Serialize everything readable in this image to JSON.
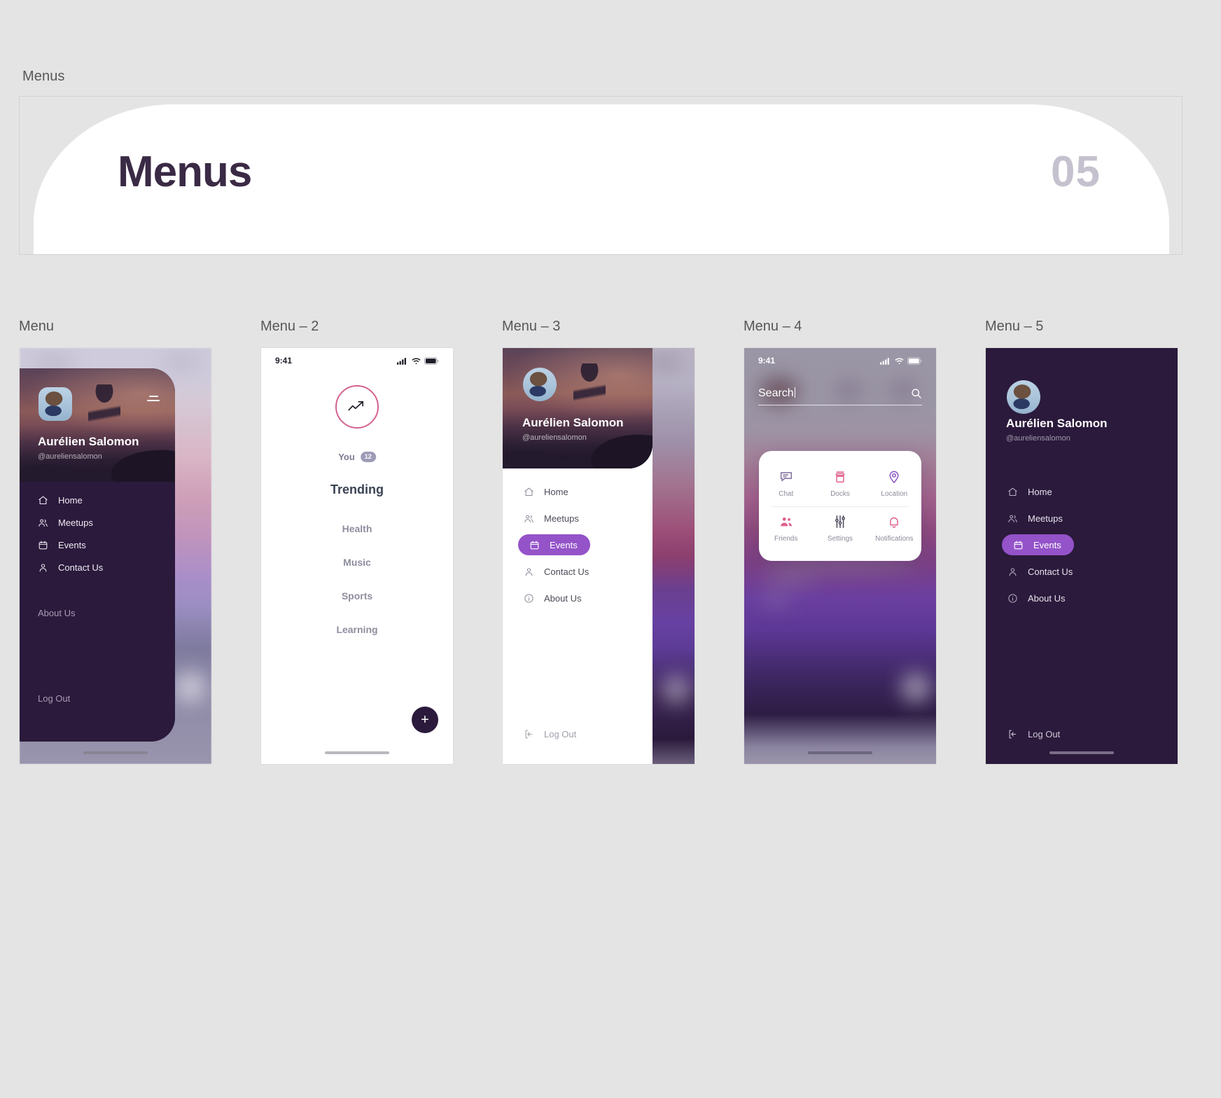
{
  "section_label": "Menus",
  "hero": {
    "title": "Menus",
    "number": "05"
  },
  "profile": {
    "name": "Aurélien Salomon",
    "handle": "@aureliensalomon"
  },
  "screens": [
    {
      "label": "Menu"
    },
    {
      "label": "Menu – 2"
    },
    {
      "label": "Menu – 3"
    },
    {
      "label": "Menu – 4"
    },
    {
      "label": "Menu – 5"
    }
  ],
  "statusbar": {
    "time": "9:41"
  },
  "menu1": {
    "items": [
      {
        "label": "Home",
        "icon": "home-icon"
      },
      {
        "label": "Meetups",
        "icon": "users-icon"
      },
      {
        "label": "Events",
        "icon": "calendar-icon"
      },
      {
        "label": "Contact Us",
        "icon": "user-icon"
      }
    ],
    "about": "About Us",
    "logout": "Log Out"
  },
  "menu2": {
    "trend_icon": "trending-up-icon",
    "you_label": "You",
    "you_badge": "12",
    "heading": "Trending",
    "items": [
      "Health",
      "Music",
      "Sports",
      "Learning"
    ],
    "fab": "+"
  },
  "menu3": {
    "items": [
      {
        "label": "Home",
        "icon": "home-icon",
        "active": false
      },
      {
        "label": "Meetups",
        "icon": "users-icon",
        "active": false
      },
      {
        "label": "Events",
        "icon": "calendar-icon",
        "active": true
      },
      {
        "label": "Contact Us",
        "icon": "user-icon",
        "active": false
      },
      {
        "label": "About Us",
        "icon": "info-icon",
        "active": false
      }
    ],
    "logout": "Log Out"
  },
  "menu4": {
    "search_value": "Search",
    "search_placeholder": "Search",
    "search_icon": "search-icon",
    "tiles": [
      {
        "label": "Chat",
        "icon": "chat-bubble-icon"
      },
      {
        "label": "Docks",
        "icon": "docks-icon"
      },
      {
        "label": "Location",
        "icon": "map-pin-icon"
      },
      {
        "label": "Friends",
        "icon": "friends-icon"
      },
      {
        "label": "Settings",
        "icon": "sliders-icon"
      },
      {
        "label": "Notifications",
        "icon": "bell-icon"
      }
    ]
  },
  "menu5": {
    "items": [
      {
        "label": "Home",
        "icon": "home-icon",
        "active": false
      },
      {
        "label": "Meetups",
        "icon": "users-icon",
        "active": false
      },
      {
        "label": "Events",
        "icon": "calendar-icon",
        "active": true
      },
      {
        "label": "Contact Us",
        "icon": "user-icon",
        "active": false
      },
      {
        "label": "About Us",
        "icon": "info-icon",
        "active": false
      }
    ],
    "logout": "Log Out"
  },
  "colors": {
    "page_bg": "#e4e4e4",
    "dark_purple": "#2b1a3c",
    "accent_purple": "#9453c9",
    "accent_pink": "#d4628f",
    "title": "#3a2a45",
    "number": "#c6c1ce"
  }
}
